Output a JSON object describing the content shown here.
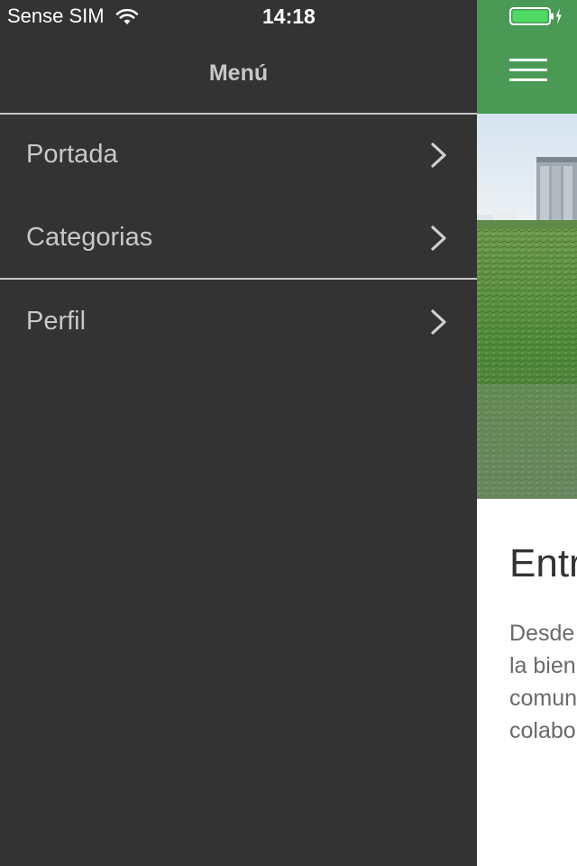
{
  "status_bar": {
    "carrier": "Sense SIM",
    "time": "14:18",
    "battery_color": "#4cd964"
  },
  "drawer": {
    "title": "Menú",
    "items": [
      {
        "label": "Portada",
        "icon": "chevron-right-icon"
      },
      {
        "label": "Categorias",
        "icon": "chevron-right-icon"
      },
      {
        "label": "Perfil",
        "icon": "chevron-right-icon"
      }
    ]
  },
  "content": {
    "appbar_color": "#4a9a55",
    "menu_icon": "hamburger-menu-icon",
    "article": {
      "title": "Entr",
      "lines": [
        "Desde",
        "la bien",
        "comun",
        "colabo"
      ]
    }
  },
  "colors": {
    "drawer_bg": "#333333",
    "drawer_text": "#c8c8c8",
    "divider": "#c6c6c6"
  }
}
